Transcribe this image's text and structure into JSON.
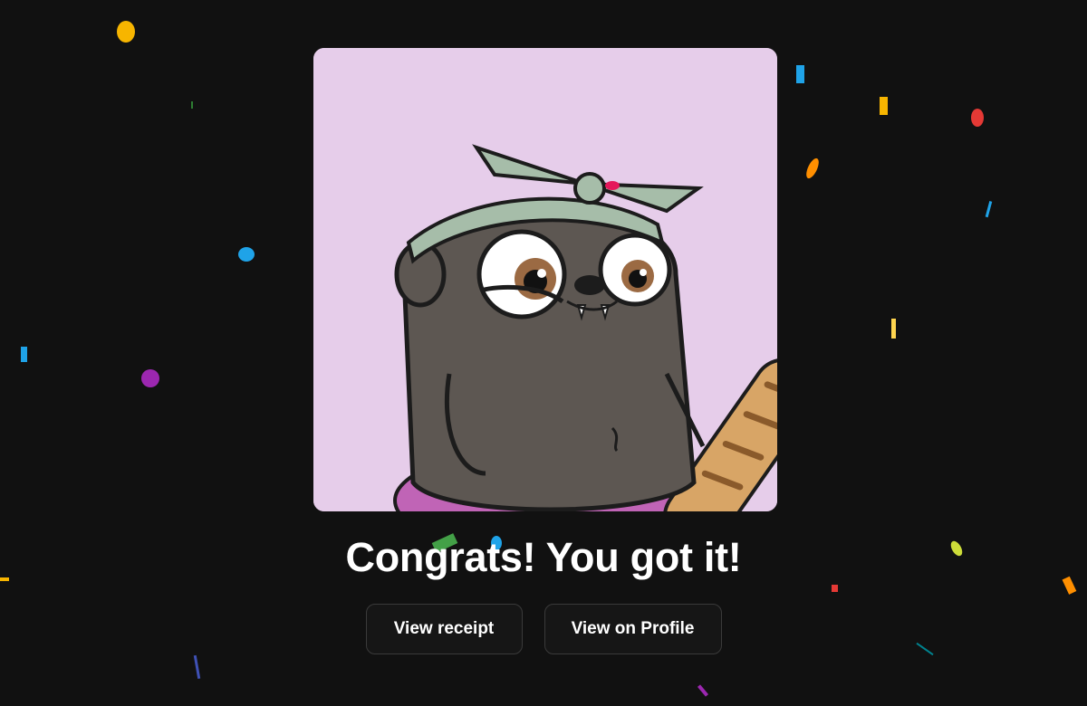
{
  "nft": {
    "image_alt": "Cartoon badger with headband holding baguette",
    "background_color": "#e6cdea"
  },
  "headline": "Congrats! You got it!",
  "actions": {
    "view_receipt_label": "View receipt",
    "view_profile_label": "View on Profile"
  },
  "theme": {
    "background": "#111111",
    "text": "#ffffff",
    "button_bg": "#161616",
    "button_border": "#3a3a3a"
  },
  "confetti_colors": [
    "#f7b500",
    "#1fa3e8",
    "#e53935",
    "#9c27b0",
    "#ffd54f",
    "#cddc39",
    "#2e7d32",
    "#ff8f00"
  ]
}
